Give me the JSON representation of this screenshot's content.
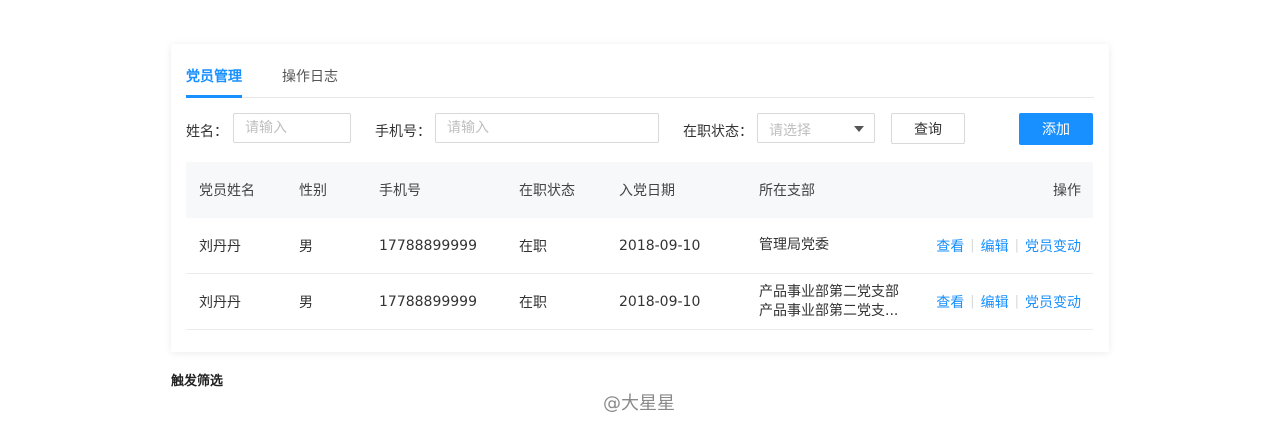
{
  "tabs": [
    {
      "label": "党员管理",
      "active": true
    },
    {
      "label": "操作日志",
      "active": false
    }
  ],
  "filters": {
    "name_label": "姓名：",
    "name_placeholder": "请输入",
    "phone_label": "手机号：",
    "phone_placeholder": "请输入",
    "status_label": "在职状态：",
    "status_placeholder": "请选择",
    "query_button": "查询",
    "add_button": "添加"
  },
  "table": {
    "headers": [
      "党员姓名",
      "性别",
      "手机号",
      "在职状态",
      "入党日期",
      "所在支部",
      "操作"
    ],
    "rows": [
      {
        "name": "刘丹丹",
        "gender": "男",
        "phone": "17788899999",
        "status": "在职",
        "date": "2018-09-10",
        "dept_line1": "管理局党委",
        "dept_line2": ""
      },
      {
        "name": "刘丹丹",
        "gender": "男",
        "phone": "17788899999",
        "status": "在职",
        "date": "2018-09-10",
        "dept_line1": "产品事业部第二党支部",
        "dept_line2": "产品事业部第二党支..."
      }
    ],
    "actions": {
      "view": "查看",
      "edit": "编辑",
      "change": "党员变动"
    }
  },
  "caption": "触发筛选",
  "watermark": "@大星星",
  "colors": {
    "accent": "#1890ff",
    "header_bg": "#f7f8fa",
    "border": "#d9d9d9"
  }
}
